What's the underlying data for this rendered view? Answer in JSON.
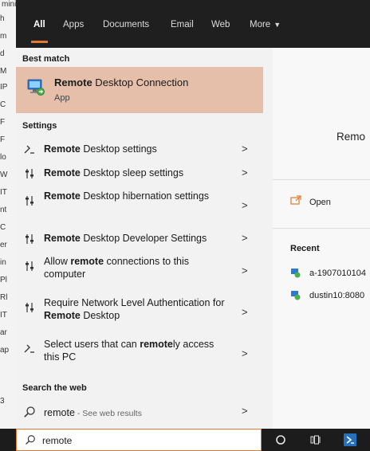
{
  "background": {
    "fragments": [
      "ministration",
      "h",
      "m",
      "d",
      "M",
      "IP",
      "C",
      "F",
      "F",
      "lo",
      "W",
      "IT",
      "nt",
      "C",
      "er",
      "in",
      "Pl",
      "Rl",
      "IT",
      "ar",
      "ap",
      "3"
    ]
  },
  "tabs": [
    {
      "label": "All",
      "active": true
    },
    {
      "label": "Apps"
    },
    {
      "label": "Documents"
    },
    {
      "label": "Email"
    },
    {
      "label": "Web"
    },
    {
      "label": "More"
    }
  ],
  "best_match": {
    "header": "Best match",
    "title_bold": "Remote",
    "title_rest": " Desktop Connection",
    "subtitle": "App",
    "icon": "remote-desktop-app-icon"
  },
  "settings": {
    "header": "Settings",
    "items": [
      {
        "icon": "remote-settings-icon",
        "parts": [
          {
            "b": "Remote"
          },
          {
            "t": " Desktop settings"
          }
        ]
      },
      {
        "icon": "sliders-icon",
        "parts": [
          {
            "b": "Remote"
          },
          {
            "t": " Desktop sleep settings"
          }
        ]
      },
      {
        "icon": "sliders-icon",
        "parts": [
          {
            "b": "Remote"
          },
          {
            "t": " Desktop hibernation settings"
          }
        ]
      },
      {
        "icon": "sliders-icon",
        "parts": [
          {
            "b": "Remote"
          },
          {
            "t": " Desktop Developer Settings"
          }
        ]
      },
      {
        "icon": "sliders-icon",
        "parts": [
          {
            "t": "Allow "
          },
          {
            "b": "remote"
          },
          {
            "t": " connections to this computer"
          }
        ]
      },
      {
        "icon": "sliders-icon",
        "parts": [
          {
            "t": "Require Network Level Authentication for "
          },
          {
            "b": "Remote"
          },
          {
            "t": " Desktop"
          }
        ]
      },
      {
        "icon": "remote-settings-icon",
        "parts": [
          {
            "t": "Select users that can "
          },
          {
            "b": "remote"
          },
          {
            "t": "ly access this PC"
          }
        ]
      }
    ]
  },
  "web": {
    "header": "Search the web",
    "query": "remote",
    "suffix": " - See web results"
  },
  "right_pane": {
    "title": "Remo",
    "open_label": "Open",
    "recent_header": "Recent",
    "recent_items": [
      "a-1907010104",
      "dustin10:8080"
    ]
  },
  "taskbar": {
    "search_value": "remote",
    "icons": [
      "cortana-icon",
      "task-view-icon",
      "powershell-icon"
    ]
  },
  "colors": {
    "accent": "#e07a2f",
    "highlight": "#e5bfa9",
    "topbar": "#1f1f1f",
    "taskbar": "#1c1c1c"
  }
}
